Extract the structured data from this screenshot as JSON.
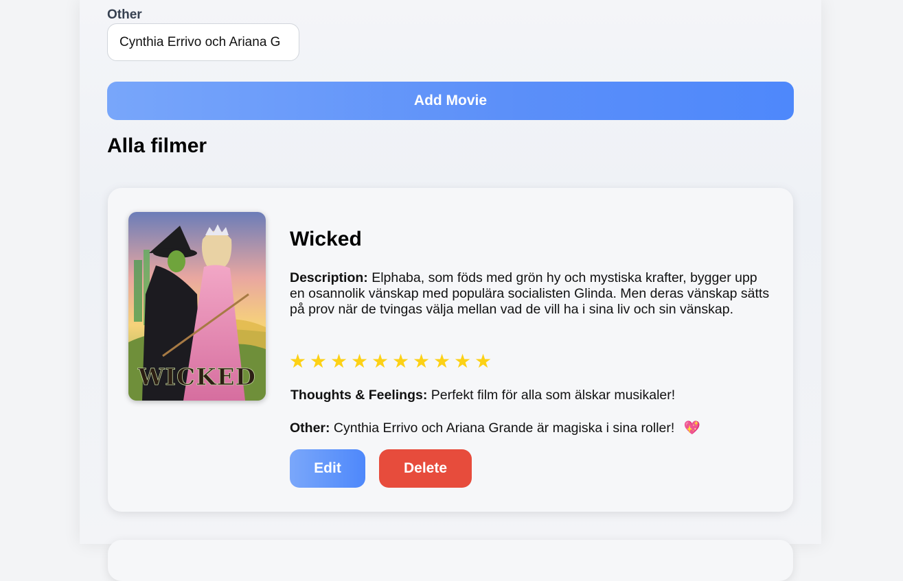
{
  "form": {
    "other_label": "Other",
    "other_value": "Cynthia Errivo och Ariana G",
    "add_button": "Add Movie"
  },
  "list": {
    "title": "Alla filmer"
  },
  "movies": [
    {
      "title": "Wicked",
      "poster_text": "WICKED",
      "description_label": "Description:",
      "description": "Elphaba, som föds med grön hy och mystiska krafter, bygger upp en osannolik vänskap med populära socialisten Glinda. Men deras vänskap sätts på prov när de tvingas välja mellan vad de vill ha i sina liv och sin vänskap.",
      "rating": 10,
      "rating_max": 10,
      "star_icon": "★",
      "thoughts_label": "Thoughts & Feelings:",
      "thoughts": "Perfekt film för alla som älskar musikaler!",
      "other_label": "Other:",
      "other": "Cynthia Errivo och Ariana Grande är magiska i sina roller!",
      "other_emoji": "💖",
      "edit_label": "Edit",
      "delete_label": "Delete"
    }
  ],
  "colors": {
    "accent": "#5b8ff9",
    "danger": "#e74c3c",
    "star": "#fcd116"
  }
}
